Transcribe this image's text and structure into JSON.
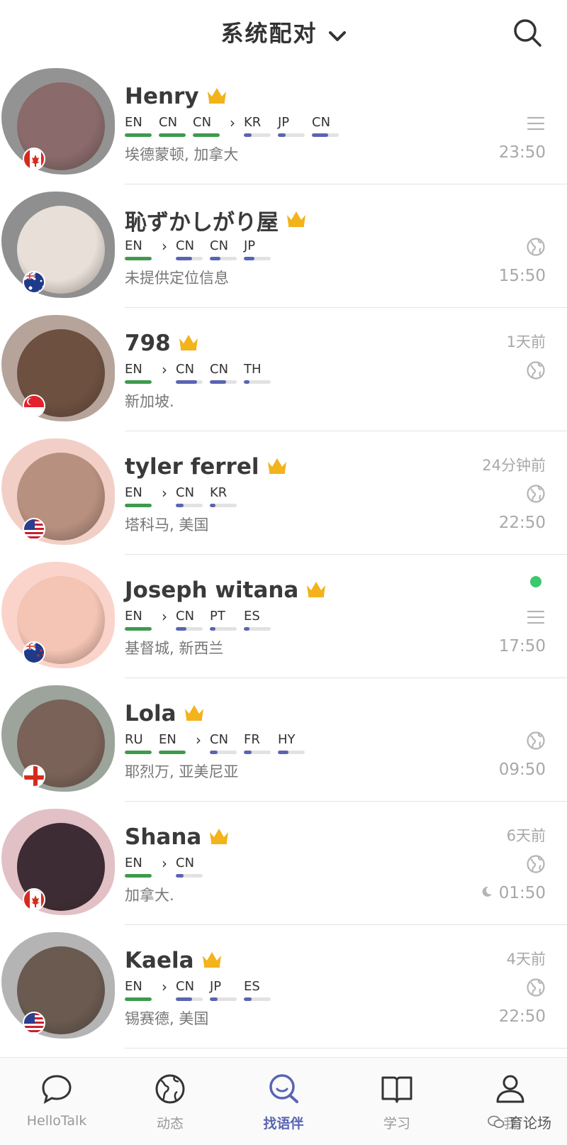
{
  "header": {
    "title": "系统配对"
  },
  "colors": {
    "native": "#3e9a4e",
    "learning": "#5a64b4",
    "track": "#e2e2e2",
    "crown": "#f2b31b",
    "online": "#3cc86e"
  },
  "users": [
    {
      "name": "Henry",
      "flag": "ca",
      "native": [
        {
          "code": "EN",
          "level": 1
        },
        {
          "code": "CN",
          "level": 1
        },
        {
          "code": "CN",
          "level": 1
        }
      ],
      "learning": [
        {
          "code": "KR",
          "level": 0.3
        },
        {
          "code": "JP",
          "level": 0.3
        },
        {
          "code": "CN",
          "level": 0.6
        }
      ],
      "location": "埃德蒙顿, 加拿大",
      "when": "",
      "status": "menu",
      "time": "23:50",
      "avatar_color": "#8a6a6a",
      "scribble": "#3a3a3a"
    },
    {
      "name": "恥ずかしがり屋",
      "flag": "au",
      "native": [
        {
          "code": "EN",
          "level": 1
        }
      ],
      "learning": [
        {
          "code": "CN",
          "level": 0.6
        },
        {
          "code": "CN",
          "level": 0.4
        },
        {
          "code": "JP",
          "level": 0.4
        }
      ],
      "location": "未提供定位信息",
      "when": "",
      "status": "globe",
      "time": "15:50",
      "avatar_color": "#e8e0d8",
      "scribble": "#333333"
    },
    {
      "name": "798",
      "flag": "sg",
      "native": [
        {
          "code": "EN",
          "level": 1
        }
      ],
      "learning": [
        {
          "code": "CN",
          "level": 0.8
        },
        {
          "code": "CN",
          "level": 0.6
        },
        {
          "code": "TH",
          "level": 0.2
        }
      ],
      "location": "新加坡.",
      "when": "1天前",
      "status": "globe",
      "time": "",
      "avatar_color": "#6e5040",
      "scribble": "#7a5a48"
    },
    {
      "name": "tyler ferrel",
      "flag": "us",
      "native": [
        {
          "code": "EN",
          "level": 1
        }
      ],
      "learning": [
        {
          "code": "CN",
          "level": 0.3
        },
        {
          "code": "KR",
          "level": 0.2
        }
      ],
      "location": "塔科马, 美国",
      "when": "24分钟前",
      "status": "globe",
      "time": "22:50",
      "avatar_color": "#b89080",
      "scribble": "#e8a898"
    },
    {
      "name": "Joseph witana",
      "flag": "nz",
      "native": [
        {
          "code": "EN",
          "level": 1
        }
      ],
      "learning": [
        {
          "code": "CN",
          "level": 0.4
        },
        {
          "code": "PT",
          "level": 0.2
        },
        {
          "code": "ES",
          "level": 0.2
        }
      ],
      "location": "基督城, 新西兰",
      "when": "",
      "status": "menu",
      "online": true,
      "time": "17:50",
      "avatar_color": "#f4c4b4",
      "scribble": "#f6b0a0"
    },
    {
      "name": "Lola",
      "flag": "en",
      "native": [
        {
          "code": "RU",
          "level": 1
        },
        {
          "code": "EN",
          "level": 1
        }
      ],
      "learning": [
        {
          "code": "CN",
          "level": 0.3
        },
        {
          "code": "FR",
          "level": 0.3
        },
        {
          "code": "HY",
          "level": 0.4
        }
      ],
      "location": "耶烈万, 亚美尼亚",
      "when": "",
      "status": "globe",
      "time": "09:50",
      "avatar_color": "#7a6258",
      "scribble": "#4a5a4a"
    },
    {
      "name": "Shana",
      "flag": "ca",
      "native": [
        {
          "code": "EN",
          "level": 1
        }
      ],
      "learning": [
        {
          "code": "CN",
          "level": 0.3
        }
      ],
      "location": "加拿大.",
      "when": "6天前",
      "status": "globe",
      "time": "01:50",
      "moon": true,
      "avatar_color": "#3e2c34",
      "scribble": "#c88c98"
    },
    {
      "name": "Kaela",
      "flag": "us",
      "native": [
        {
          "code": "EN",
          "level": 1
        }
      ],
      "learning": [
        {
          "code": "CN",
          "level": 0.6
        },
        {
          "code": "JP",
          "level": 0.3
        },
        {
          "code": "ES",
          "level": 0.3
        }
      ],
      "location": "锡赛德, 美国",
      "when": "4天前",
      "status": "globe",
      "time": "22:50",
      "avatar_color": "#6a5a50",
      "scribble": "#777777"
    }
  ],
  "tabs": [
    {
      "label": "HelloTalk",
      "icon": "chat-bubble-icon",
      "active": false
    },
    {
      "label": "动态",
      "icon": "globe-icon",
      "active": false
    },
    {
      "label": "找语伴",
      "icon": "search-chat-icon",
      "active": true
    },
    {
      "label": "学习",
      "icon": "book-icon",
      "active": false
    },
    {
      "label": "我",
      "icon": "profile-icon",
      "active": false
    }
  ],
  "watermark": "育论场"
}
